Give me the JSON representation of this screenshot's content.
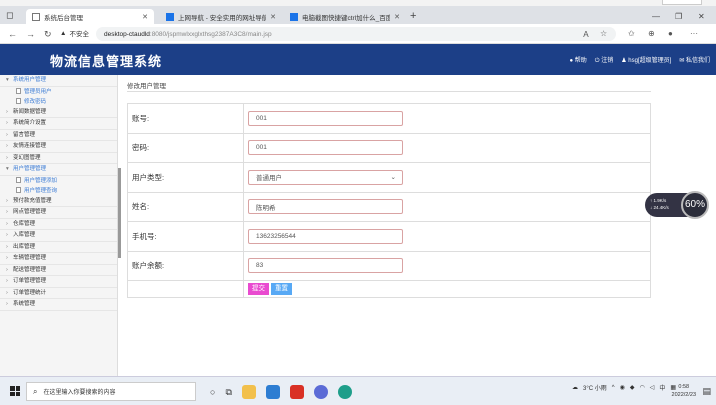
{
  "browser": {
    "tabs": [
      {
        "label": "系统后台管理"
      },
      {
        "label": "上网导航 - 安全实用的网址导航"
      },
      {
        "label": "电脑截图快捷键ctrl加什么_百度"
      }
    ],
    "address": {
      "security_label": "不安全",
      "host": "desktop-ctaudld",
      "path": ":8080/jspmwlxxglxthsg2387A3C8/main.jsp"
    }
  },
  "app": {
    "title": "物流信息管理系统",
    "header_links": [
      {
        "icon": "help-icon",
        "label": "帮助"
      },
      {
        "icon": "power-icon",
        "label": "注销"
      },
      {
        "icon": "user-icon",
        "label": "hsg[超级管理员]"
      },
      {
        "icon": "mail-icon",
        "label": "私信我们"
      }
    ]
  },
  "sidebar": {
    "items": [
      {
        "label": "系统用户管理",
        "open": true,
        "children": [
          "管理员用户",
          "修改密码"
        ]
      },
      {
        "label": "新闻数据管理"
      },
      {
        "label": "系统简介设置"
      },
      {
        "label": "留言管理"
      },
      {
        "label": "友情连接管理"
      },
      {
        "label": "变幻图管理"
      },
      {
        "label": "用户管理管理",
        "open": true,
        "children": [
          "用户管理添加",
          "用户管理查询"
        ]
      },
      {
        "label": "预付款充值管理"
      },
      {
        "label": "网点管理管理"
      },
      {
        "label": "仓库管理"
      },
      {
        "label": "入库管理"
      },
      {
        "label": "出库管理"
      },
      {
        "label": "车辆管理管理"
      },
      {
        "label": "配送管理管理"
      },
      {
        "label": "订单管理管理"
      },
      {
        "label": "订单管理统计"
      },
      {
        "label": "系统管理"
      }
    ]
  },
  "main": {
    "breadcrumb": "修改用户管理",
    "fields": [
      {
        "label": "账号:",
        "value": "001"
      },
      {
        "label": "密码:",
        "value": "001"
      },
      {
        "label": "用户类型:",
        "value": "普通用户",
        "type": "select"
      },
      {
        "label": "姓名:",
        "value": "陈明希"
      },
      {
        "label": "手机号:",
        "value": "13623256544"
      },
      {
        "label": "账户余额:",
        "value": "83"
      }
    ],
    "submit_label": "提交",
    "reset_label": "重置"
  },
  "widget": {
    "up": "1.9K/s",
    "down": "24.4K/s",
    "percent": "60%"
  },
  "taskbar": {
    "search_placeholder": "在这里输入你要搜索的内容",
    "weather": "3°C 小雨",
    "ime": "中",
    "time": "0:58",
    "date": "2022/2/23"
  },
  "colors": {
    "header_bg": "#1c3f87",
    "sidebar_link": "#3a7bd5",
    "submit_bg": "#e94bd0",
    "reset_bg": "#58a9f5"
  }
}
